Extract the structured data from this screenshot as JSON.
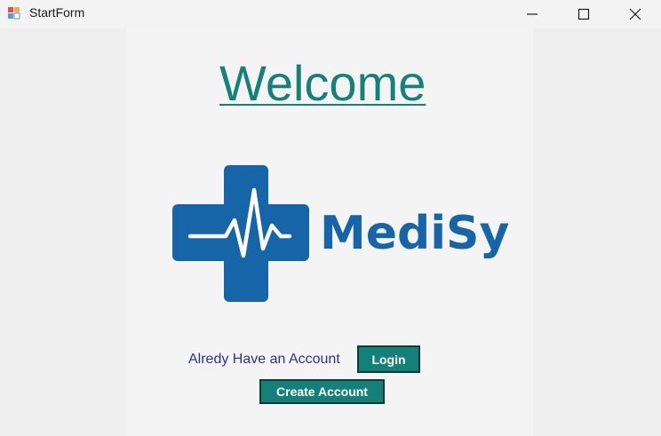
{
  "window": {
    "title": "StartForm",
    "icon": "winforms-app-icon",
    "controls": [
      "minimize-icon",
      "maximize-icon",
      "close-icon"
    ]
  },
  "main": {
    "heading": "Welcome",
    "logo_text": "MediSys",
    "account_prompt": "Alredy Have an Account",
    "login_label": "Login",
    "create_account_label": "Create Account"
  },
  "colors": {
    "accent": "#16807a",
    "logo_blue": "#1565a8",
    "prompt_text": "#29339a",
    "button_bg": "#14807a"
  }
}
